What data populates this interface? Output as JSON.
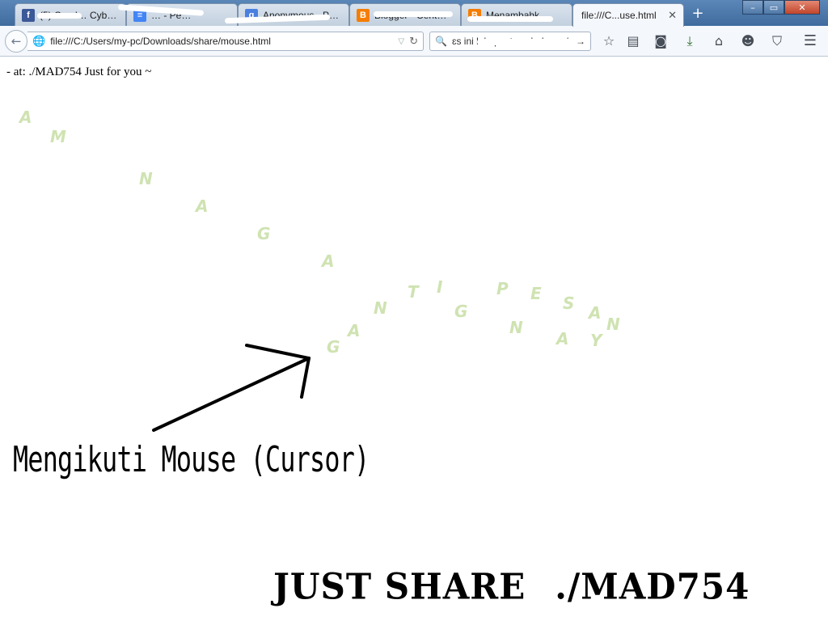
{
  "tabs": [
    {
      "label": "(5) Cerul… Cyber…",
      "favicon": "facebook-icon",
      "color": "#3b5998",
      "glyph": "f"
    },
    {
      "label": "… - Pe…",
      "favicon": "google-docs-icon",
      "color": "#4285f4",
      "glyph": "≡"
    },
    {
      "label": "Anonymous - Pe…",
      "favicon": "google-icon",
      "color": "#4a7fe0",
      "glyph": "g"
    },
    {
      "label": "Blogger - Cerit…",
      "favicon": "blogger-icon",
      "color": "#f57d00",
      "glyph": "B"
    },
    {
      "label": "Menambahk…",
      "favicon": "blogger-icon",
      "color": "#f57d00",
      "glyph": "B"
    },
    {
      "label": "file:///C...use.html",
      "favicon": "",
      "color": "",
      "glyph": ""
    }
  ],
  "new_tab_symbol": "+",
  "window_controls": {
    "minimize": "–",
    "maximize": "▭",
    "close": "✕"
  },
  "nav": {
    "back": "←",
    "url": "file:///C:/Users/my-pc/Downloads/share/mouse.html",
    "search_text": "ɛs ini lalu paste sebelum </div>",
    "search_go": "→"
  },
  "toolbar_icons": [
    "bookmark-star-icon",
    "reading-list-icon",
    "pocket-icon",
    "download-icon",
    "home-icon",
    "chat-icon",
    "shield-icon",
    "menu-icon"
  ],
  "page": {
    "header": "- at: ./MAD754 Just for you ~",
    "trail_letters": [
      "A",
      "M",
      "N",
      "A",
      "G",
      "A",
      "G",
      "A",
      "N",
      "T",
      "I",
      "G",
      "P",
      "N",
      "E",
      "A",
      "S",
      "Y",
      "A",
      "N"
    ],
    "caption": "Mengikuti Mouse (Cursor)",
    "footer_left": "JUST SHARE",
    "footer_right": "./MAD754"
  }
}
